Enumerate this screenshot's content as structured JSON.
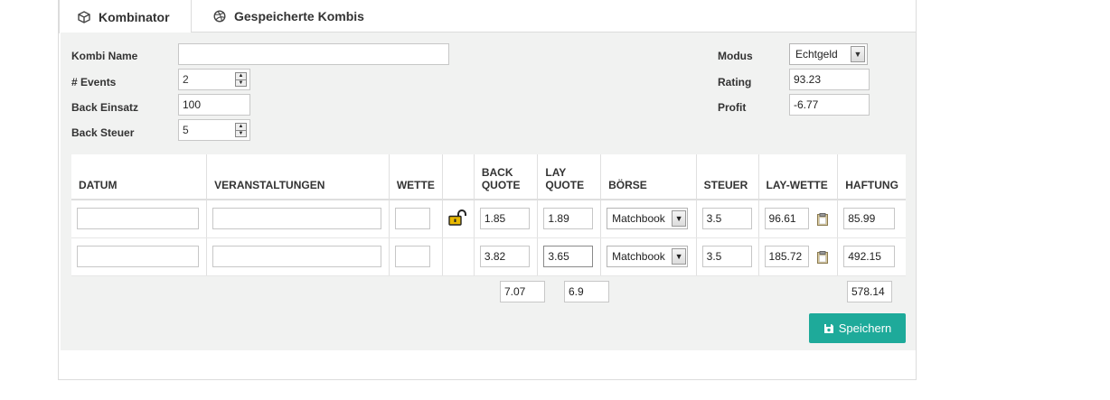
{
  "tabs": [
    {
      "label": "Kombinator",
      "icon": "cube-icon",
      "active": true
    },
    {
      "label": "Gespeicherte Kombis",
      "icon": "dribbble-icon",
      "active": false
    }
  ],
  "form": {
    "kombi_name_label": "Kombi Name",
    "kombi_name_value": "",
    "events_label": "# Events",
    "events_value": "2",
    "back_einsatz_label": "Back Einsatz",
    "back_einsatz_value": "100",
    "back_steuer_label": "Back Steuer",
    "back_steuer_value": "5",
    "modus_label": "Modus",
    "modus_value": "Echtgeld",
    "rating_label": "Rating",
    "rating_value": "93.23",
    "profit_label": "Profit",
    "profit_value": "-6.77"
  },
  "table": {
    "headers": {
      "datum": "DATUM",
      "veranstaltungen": "VERANSTALTUNGEN",
      "wette": "WETTE",
      "back_quote_1": "BACK",
      "back_quote_2": "QUOTE",
      "lay_quote_1": "LAY",
      "lay_quote_2": "QUOTE",
      "boerse": "BÖRSE",
      "steuer": "STEUER",
      "lay_wette": "LAY-WETTE",
      "haftung": "HAFTUNG"
    },
    "rows": [
      {
        "datum": "",
        "veranstaltung": "",
        "wette": "",
        "locked": false,
        "back_quote": "1.85",
        "lay_quote": "1.89",
        "boerse": "Matchbook",
        "steuer": "3.5",
        "lay_wette": "96.61",
        "haftung": "85.99"
      },
      {
        "datum": "",
        "veranstaltung": "",
        "wette": "",
        "locked": null,
        "back_quote": "3.82",
        "lay_quote": "3.65",
        "boerse": "Matchbook",
        "steuer": "3.5",
        "lay_wette": "185.72",
        "haftung": "492.15"
      }
    ],
    "totals": {
      "back_quote": "7.07",
      "lay_quote": "6.9",
      "haftung": "578.14"
    }
  },
  "save_button_label": "Speichern",
  "colors": {
    "accent": "#1eaa9a",
    "panel": "#f1f2f1",
    "lock": "#e8b800"
  }
}
